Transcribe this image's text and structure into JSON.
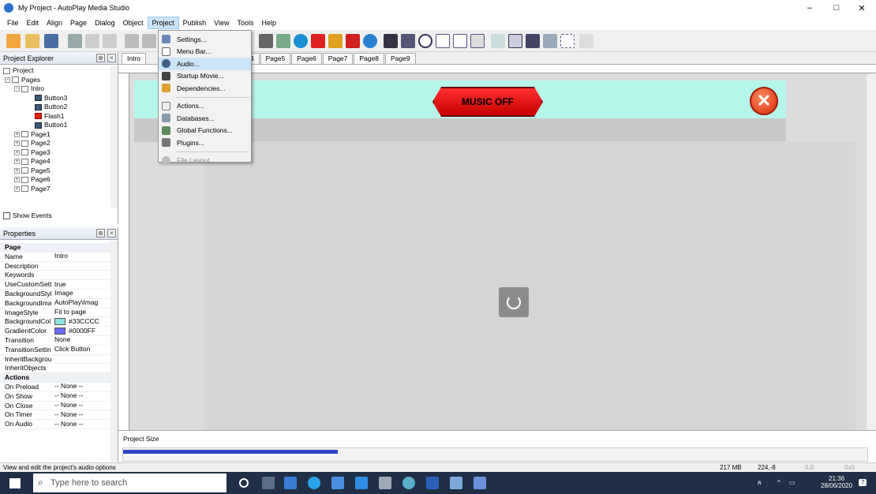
{
  "window": {
    "title": "My Project - AutoPlay Media Studio",
    "min": "–",
    "max": "□",
    "close": "✕"
  },
  "menubar": {
    "items": [
      "File",
      "Edit",
      "Align",
      "Page",
      "Dialog",
      "Object",
      "Project",
      "Publish",
      "View",
      "Tools",
      "Help"
    ],
    "open": "Project"
  },
  "project_menu": {
    "items": [
      {
        "label": "Settings...",
        "icon": "settings-icon"
      },
      {
        "label": "Menu Bar...",
        "icon": "menubar-icon"
      },
      {
        "label": "Audio...",
        "icon": "audio-icon",
        "highlighted": true
      },
      {
        "label": "Startup Movie...",
        "icon": "movie-icon"
      },
      {
        "label": "Dependencies...",
        "icon": "dependencies-icon"
      },
      {
        "label": "Actions...",
        "icon": "actions-icon"
      },
      {
        "label": "Databases...",
        "icon": "database-icon"
      },
      {
        "label": "Global Functions...",
        "icon": "functions-icon"
      },
      {
        "label": "Plugins...",
        "icon": "plugins-icon"
      },
      {
        "label": "File Layout...",
        "icon": "filelayout-icon",
        "disabled": true
      }
    ]
  },
  "explorer": {
    "title": "Project Explorer",
    "tree": [
      "Project",
      "Pages",
      "Intro",
      "Button3",
      "Button2",
      "Flash1",
      "Button1",
      "Page1",
      "Page2",
      "Page3",
      "Page4",
      "Page5",
      "Page6",
      "Page7"
    ],
    "show_events": "Show Events"
  },
  "properties": {
    "title": "Properties",
    "page_section": "Page",
    "rows": [
      {
        "k": "Name",
        "v": "Intro"
      },
      {
        "k": "Description",
        "v": ""
      },
      {
        "k": "Keywords",
        "v": ""
      },
      {
        "k": "UseCustomSett",
        "v": "true"
      },
      {
        "k": "BackgroundStyl",
        "v": "Image"
      },
      {
        "k": "BackgroundIma",
        "v": "AutoPlay\\Imag"
      },
      {
        "k": "ImageStyle",
        "v": "Fit to page"
      },
      {
        "k": "BackgroundCol",
        "v": "#33CCCC",
        "swatch": "#8fe0e0"
      },
      {
        "k": "GradientColor",
        "v": "#0000FF",
        "swatch": "#6a6aff"
      },
      {
        "k": "Transition",
        "v": "None"
      },
      {
        "k": "TransitionSettin",
        "v": "Click Button"
      },
      {
        "k": "InheritBackgrou",
        "v": ""
      },
      {
        "k": "InheritObjects",
        "v": ""
      }
    ],
    "actions_section": "Actions",
    "action_rows": [
      {
        "k": "On Preload",
        "v": "-- None --"
      },
      {
        "k": "On Show",
        "v": "-- None --"
      },
      {
        "k": "On Close",
        "v": "-- None --"
      },
      {
        "k": "On Timer",
        "v": "-- None --"
      },
      {
        "k": "On Audio",
        "v": "-- None --"
      }
    ]
  },
  "page_tabs": [
    "Intro",
    "Page4",
    "Page5",
    "Page6",
    "Page7",
    "Page8",
    "Page9"
  ],
  "canvas": {
    "music_button": "MUSIC OFF"
  },
  "project_size": {
    "label": "Project Size",
    "fill_fraction": 0.288
  },
  "status": {
    "text": "View and edit the project's audio options",
    "memory": "217 MB",
    "coords": "224,-8",
    "size1": "0,0",
    "size2": "0x0"
  },
  "taskbar": {
    "search_placeholder": "Type here to search",
    "time": "21:36",
    "date": "28/06/2020",
    "notifications": "7"
  },
  "colors": {
    "accent": "#cce4f7",
    "banner": "#b6f5ea",
    "music_button": "#e00000",
    "size_bar": "#2f46c6"
  }
}
